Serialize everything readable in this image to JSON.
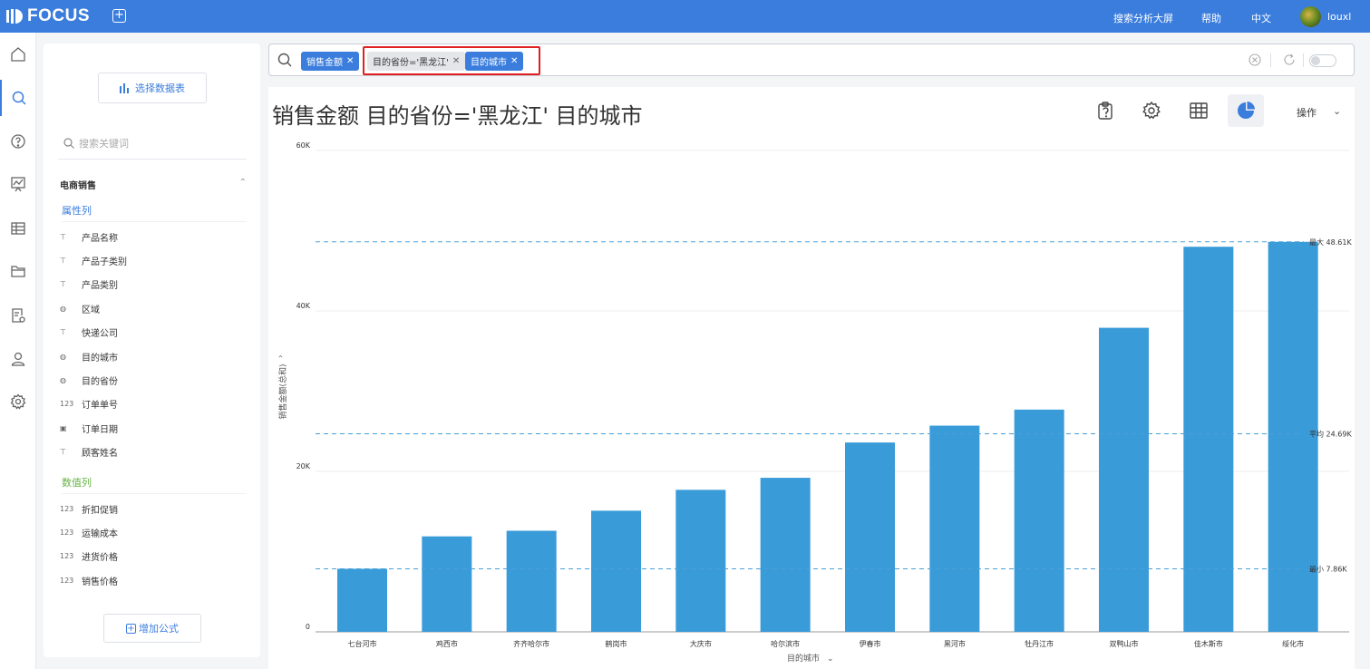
{
  "app": {
    "brand": "FOCUS",
    "add_tab_icon": "plus-square-icon"
  },
  "topbar": {
    "dashboard": "搜索分析大屏",
    "help": "帮助",
    "lang": "中文",
    "user": "louxl"
  },
  "left_nav": [
    "home-icon",
    "search-icon",
    "help-circle-icon",
    "presentation-chart-icon",
    "table-grid-icon",
    "folder-icon",
    "data-settings-icon",
    "user-icon",
    "settings-icon"
  ],
  "panel": {
    "select_table": "选择数据表",
    "keyword_placeholder": "搜索关键词",
    "group_name": "电商销售",
    "attr_section": "属性列",
    "attr_fields": [
      {
        "type": "T",
        "name": "产品名称"
      },
      {
        "type": "T",
        "name": "产品子类别"
      },
      {
        "type": "T",
        "name": "产品类别"
      },
      {
        "type": "globe",
        "name": "区域"
      },
      {
        "type": "T",
        "name": "快递公司"
      },
      {
        "type": "globe",
        "name": "目的城市"
      },
      {
        "type": "globe",
        "name": "目的省份"
      },
      {
        "type": "123",
        "name": "订单单号"
      },
      {
        "type": "cal",
        "name": "订单日期"
      },
      {
        "type": "T",
        "name": "顾客姓名"
      }
    ],
    "num_section": "数值列",
    "num_fields": [
      {
        "type": "123",
        "name": "折扣促销"
      },
      {
        "type": "123",
        "name": "运输成本"
      },
      {
        "type": "123",
        "name": "进货价格"
      },
      {
        "type": "123",
        "name": "销售价格"
      }
    ],
    "add_formula": "增加公式"
  },
  "search": {
    "tokens": [
      "销售金额",
      "目的省份='黑龙江'",
      "目的城市"
    ]
  },
  "main": {
    "title": "销售金额 目的省份='黑龙江' 目的城市",
    "ops_label": "操作"
  },
  "colors": {
    "accent": "#3b7ddd",
    "bar": "#3a9bd9",
    "ref_line": "#4a9fd8",
    "highlight": "#e02020"
  },
  "chart_data": {
    "type": "bar",
    "categories": [
      "七台河市",
      "鸡西市",
      "齐齐哈尔市",
      "鹤岗市",
      "大庆市",
      "哈尔滨市",
      "伊春市",
      "黑河市",
      "牡丹江市",
      "双鸭山市",
      "佳木斯市",
      "绥化市"
    ],
    "values": [
      7860,
      11900,
      12600,
      15100,
      17700,
      19200,
      23600,
      25700,
      27700,
      37900,
      48000,
      48610
    ],
    "xlabel": "目的城市",
    "ylabel": "销售金额(总和)",
    "ylim": [
      0,
      60000
    ],
    "yticks": [
      0,
      20000,
      40000,
      60000
    ],
    "ytick_labels": [
      "0",
      "20K",
      "40K",
      "60K"
    ],
    "reference_lines": [
      {
        "label": "最大 48.61K",
        "value": 48610
      },
      {
        "label": "平均 24.69K",
        "value": 24690
      },
      {
        "label": "最小 7.86K",
        "value": 7860
      }
    ],
    "grid": true
  }
}
